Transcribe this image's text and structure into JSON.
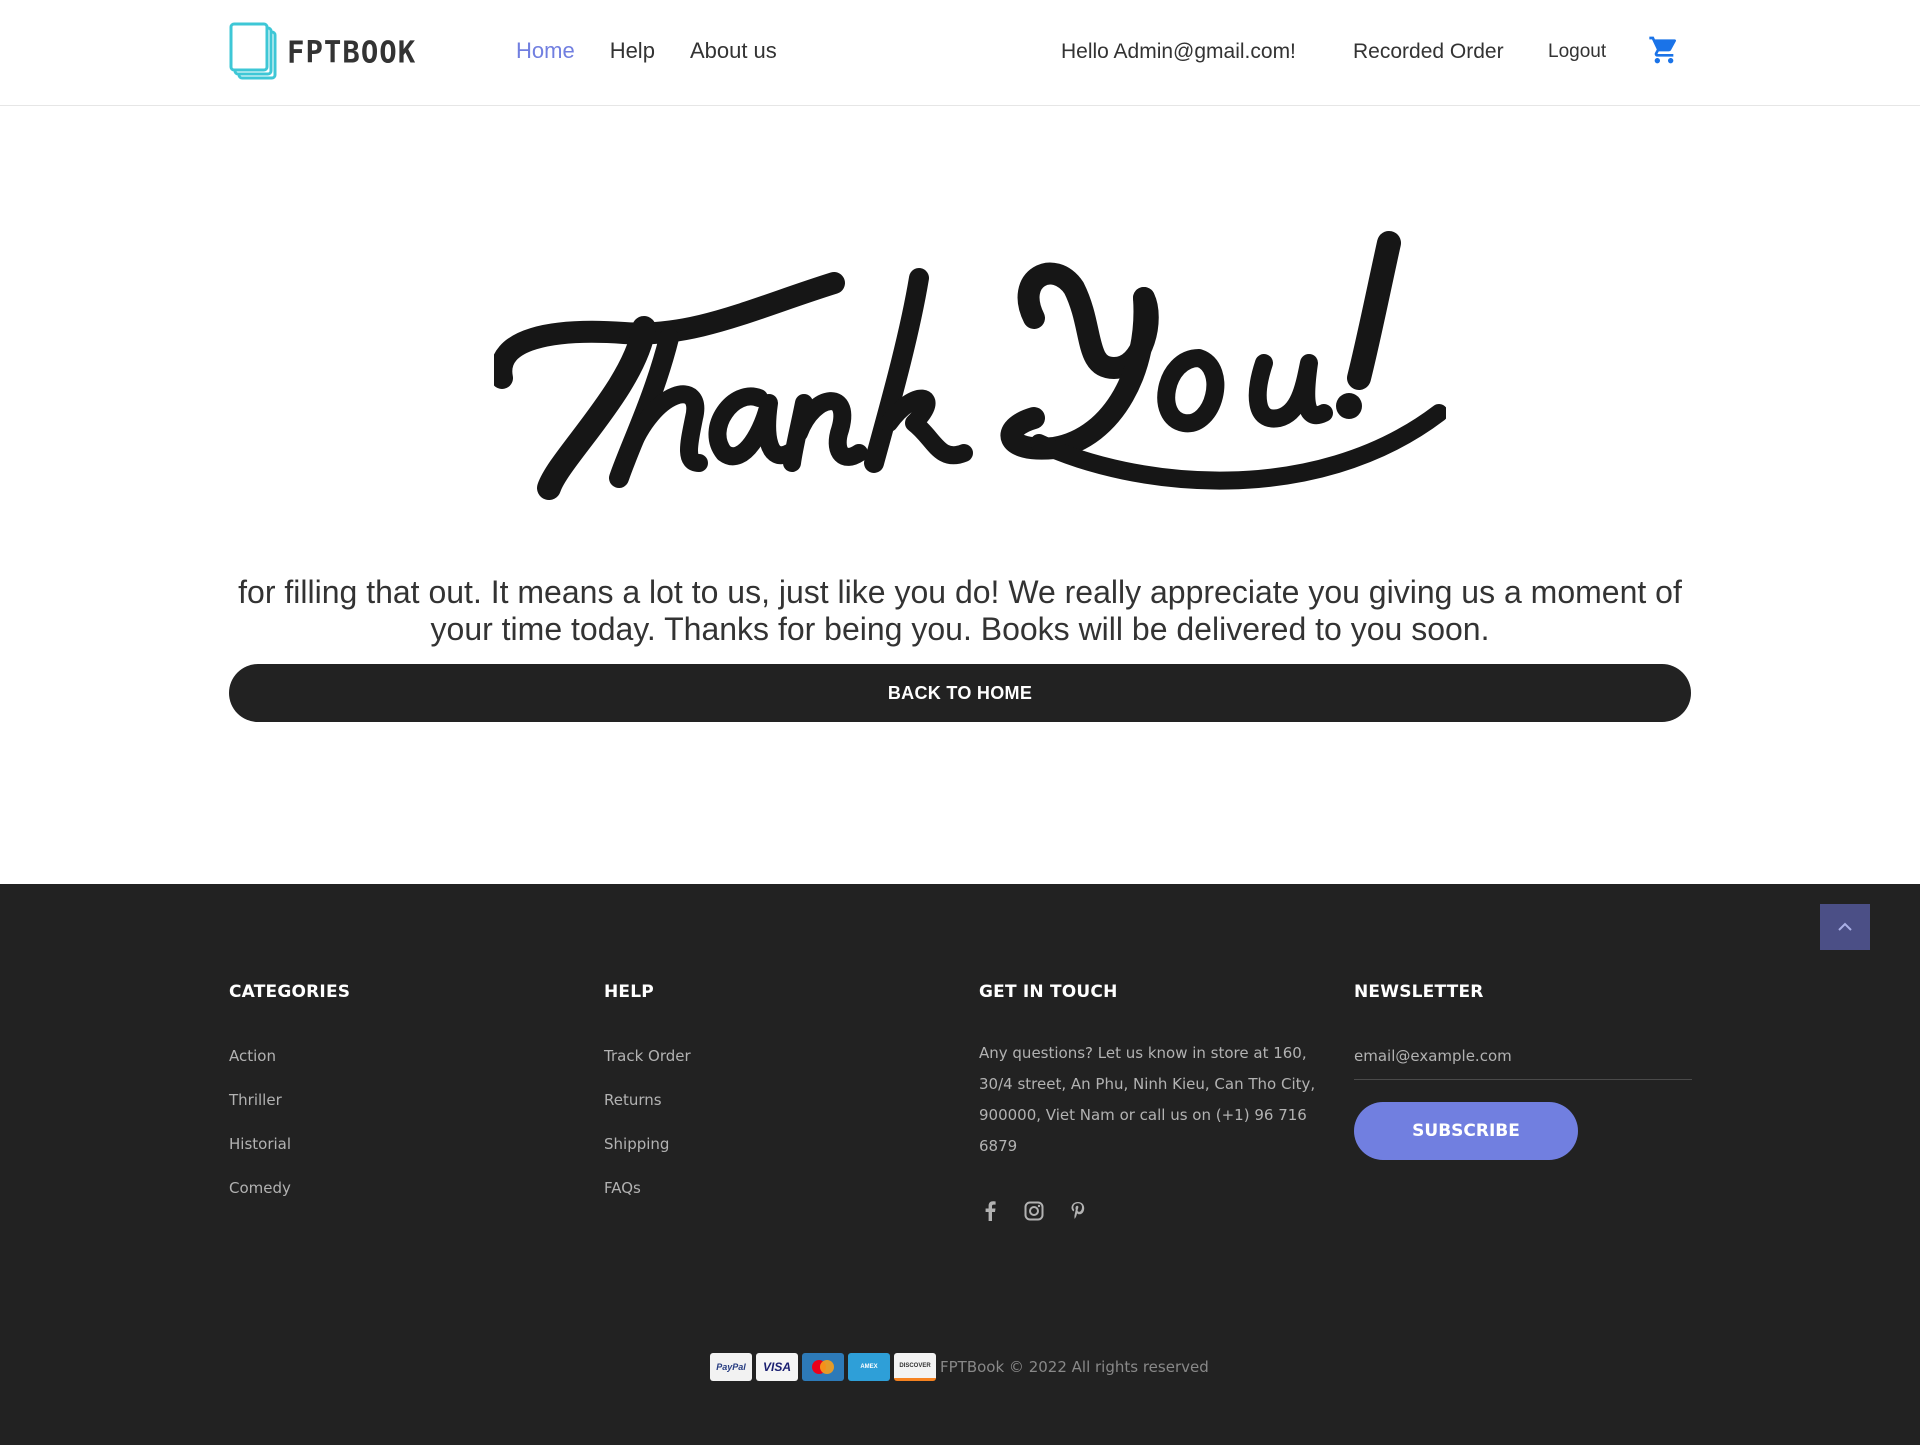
{
  "brand": {
    "name": "FPTBOOK"
  },
  "nav": {
    "home": "Home",
    "help": "Help",
    "about": "About us"
  },
  "user_nav": {
    "greeting": "Hello Admin@gmail.com!",
    "recorded_order": "Recorded Order",
    "logout": "Logout",
    "cart_icon": "cart-icon"
  },
  "main": {
    "headline_image": "Thank You!",
    "message": "for filling that out. It means a lot to us, just like you do! We really appreciate you giving us a moment of your time today. Thanks for being you. Books will be delivered to you soon.",
    "back_button": "BACK TO HOME"
  },
  "footer": {
    "categories": {
      "title": "CATEGORIES",
      "items": [
        "Action",
        "Thriller",
        "Historial",
        "Comedy"
      ]
    },
    "help": {
      "title": "HELP",
      "items": [
        "Track Order",
        "Returns",
        "Shipping",
        "FAQs"
      ]
    },
    "touch": {
      "title": "GET IN TOUCH",
      "text": "Any questions? Let us know in store at 160, 30/4 street, An Phu, Ninh Kieu, Can Tho City, 900000, Viet Nam or call us on (+1) 96 716 6879",
      "socials": [
        "facebook-icon",
        "instagram-icon",
        "pinterest-icon"
      ]
    },
    "newsletter": {
      "title": "NEWSLETTER",
      "placeholder": "email@example.com",
      "button": "SUBSCRIBE"
    },
    "payments": [
      "PayPal",
      "VISA",
      "MasterCard",
      "American Express",
      "DISCOVER"
    ],
    "copyright": "FPTBook © 2022 All rights reserved"
  },
  "colors": {
    "accent": "#717fe0",
    "dark": "#222222",
    "cart": "#1a73e8",
    "logo": "#3ec7d6",
    "to_top": "#4b4f86"
  }
}
